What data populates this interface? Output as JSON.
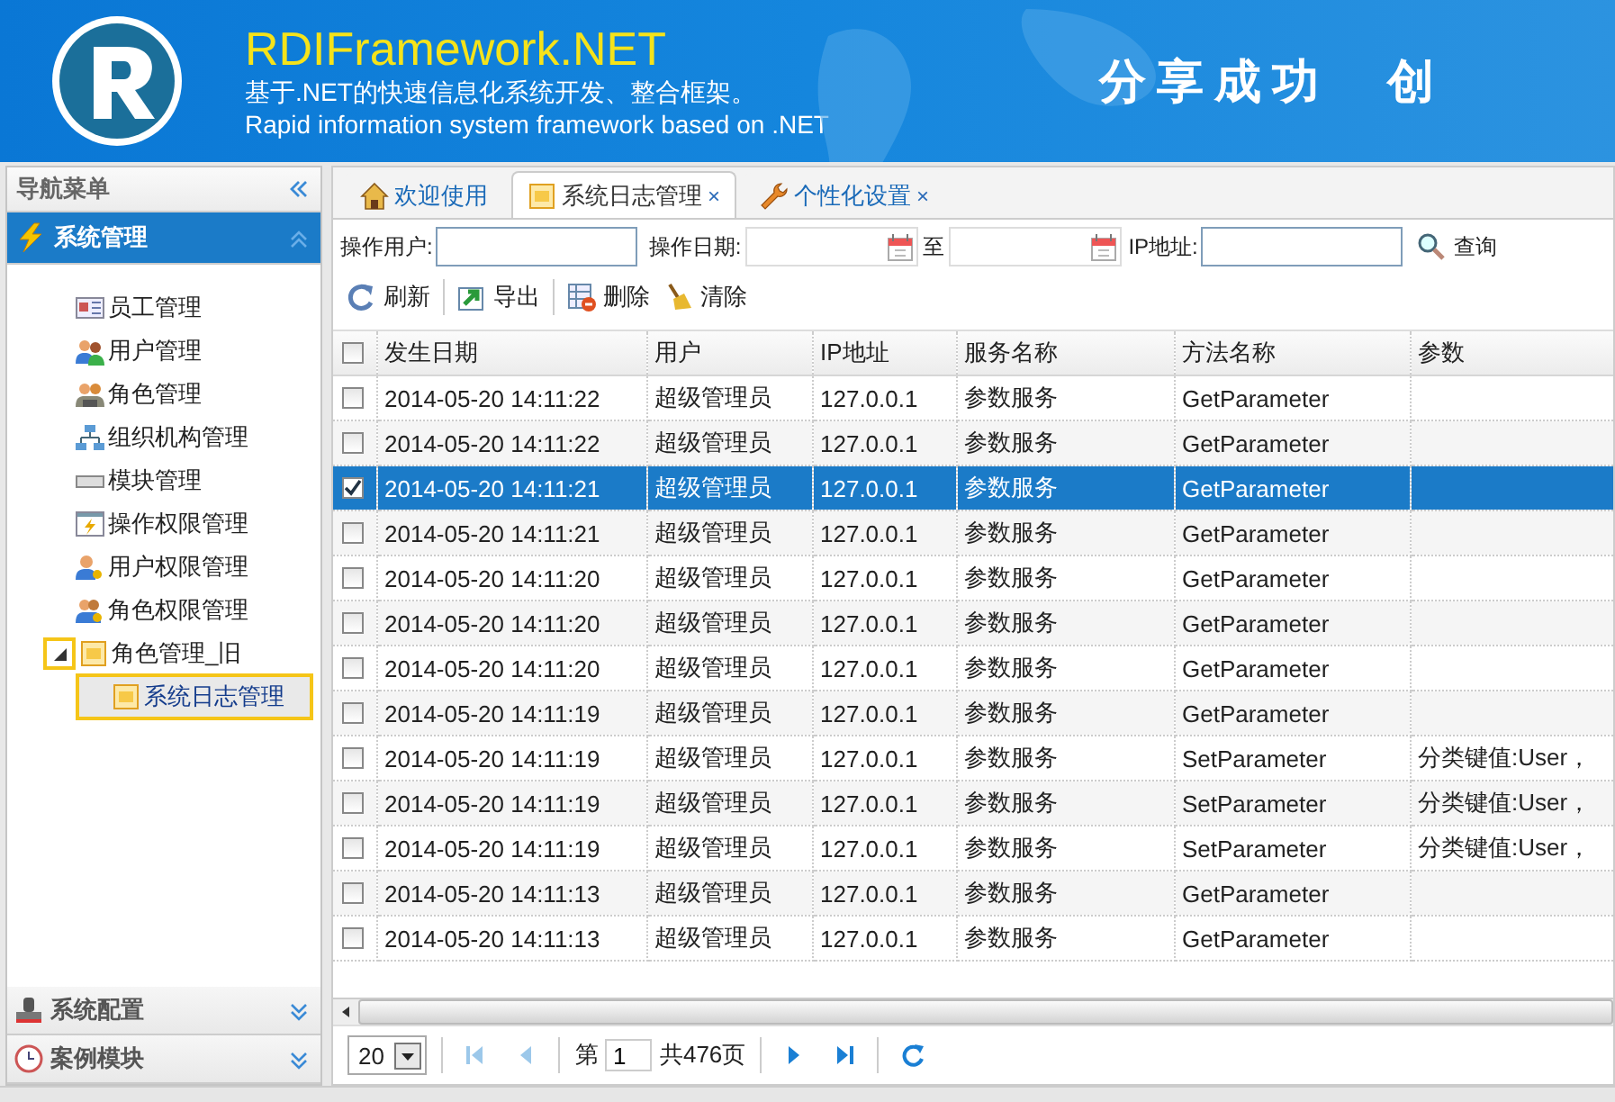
{
  "header": {
    "title": "RDIFramework.NET",
    "slogan_cn": "基于.NET的快速信息化系统开发、整合框架。",
    "slogan_en": "Rapid information system framework based on .NET",
    "motto": "分享成功　创"
  },
  "sidebar": {
    "title": "导航菜单",
    "panels": [
      {
        "label": "系统管理",
        "expanded": true,
        "items": [
          {
            "label": "员工管理",
            "selected": false
          },
          {
            "label": "用户管理",
            "selected": false
          },
          {
            "label": "角色管理",
            "selected": false
          },
          {
            "label": "组织机构管理",
            "selected": false
          },
          {
            "label": "模块管理",
            "selected": false
          },
          {
            "label": "操作权限管理",
            "selected": false
          },
          {
            "label": "用户权限管理",
            "selected": false
          },
          {
            "label": "角色权限管理",
            "selected": false
          },
          {
            "label": "角色管理_旧",
            "selected": false,
            "expanded": true,
            "children": [
              {
                "label": "系统日志管理",
                "selected": true
              }
            ]
          }
        ]
      },
      {
        "label": "系统配置",
        "expanded": false
      },
      {
        "label": "案例模块",
        "expanded": false
      }
    ]
  },
  "tabs": [
    {
      "label": "欢迎使用",
      "selected": false
    },
    {
      "label": "系统日志管理",
      "selected": true,
      "close": "×"
    },
    {
      "label": "个性化设置",
      "selected": false,
      "close": "×"
    }
  ],
  "filters": [
    {
      "label": "操作用户:",
      "kind": "text"
    },
    {
      "label": "操作日期:",
      "kind": "date"
    },
    {
      "label": "至",
      "kind": "date"
    },
    {
      "label": "IP地址:",
      "kind": "text"
    }
  ],
  "search_button": "查询",
  "toolbar": [
    "刷新",
    "导出",
    "删除",
    "清除"
  ],
  "table": {
    "all_checked": false,
    "columns": [
      "发生日期",
      "用户",
      "IP地址",
      "服务名称",
      "方法名称",
      "参数"
    ],
    "rows": [
      {
        "cells": [
          "2014-05-20 14:11:22",
          "超级管理员",
          "127.0.0.1",
          "参数服务",
          "GetParameter",
          ""
        ],
        "checked": false,
        "selected": false
      },
      {
        "cells": [
          "2014-05-20 14:11:22",
          "超级管理员",
          "127.0.0.1",
          "参数服务",
          "GetParameter",
          ""
        ],
        "checked": false,
        "selected": false
      },
      {
        "cells": [
          "2014-05-20 14:11:21",
          "超级管理员",
          "127.0.0.1",
          "参数服务",
          "GetParameter",
          ""
        ],
        "checked": true,
        "selected": true
      },
      {
        "cells": [
          "2014-05-20 14:11:21",
          "超级管理员",
          "127.0.0.1",
          "参数服务",
          "GetParameter",
          ""
        ],
        "checked": false,
        "selected": false
      },
      {
        "cells": [
          "2014-05-20 14:11:20",
          "超级管理员",
          "127.0.0.1",
          "参数服务",
          "GetParameter",
          ""
        ],
        "checked": false,
        "selected": false
      },
      {
        "cells": [
          "2014-05-20 14:11:20",
          "超级管理员",
          "127.0.0.1",
          "参数服务",
          "GetParameter",
          ""
        ],
        "checked": false,
        "selected": false
      },
      {
        "cells": [
          "2014-05-20 14:11:20",
          "超级管理员",
          "127.0.0.1",
          "参数服务",
          "GetParameter",
          ""
        ],
        "checked": false,
        "selected": false
      },
      {
        "cells": [
          "2014-05-20 14:11:19",
          "超级管理员",
          "127.0.0.1",
          "参数服务",
          "GetParameter",
          ""
        ],
        "checked": false,
        "selected": false
      },
      {
        "cells": [
          "2014-05-20 14:11:19",
          "超级管理员",
          "127.0.0.1",
          "参数服务",
          "SetParameter",
          "分类键值:User，"
        ],
        "checked": false,
        "selected": false
      },
      {
        "cells": [
          "2014-05-20 14:11:19",
          "超级管理员",
          "127.0.0.1",
          "参数服务",
          "SetParameter",
          "分类键值:User，"
        ],
        "checked": false,
        "selected": false
      },
      {
        "cells": [
          "2014-05-20 14:11:19",
          "超级管理员",
          "127.0.0.1",
          "参数服务",
          "SetParameter",
          "分类键值:User，"
        ],
        "checked": false,
        "selected": false
      },
      {
        "cells": [
          "2014-05-20 14:11:13",
          "超级管理员",
          "127.0.0.1",
          "参数服务",
          "GetParameter",
          ""
        ],
        "checked": false,
        "selected": false
      },
      {
        "cells": [
          "2014-05-20 14:11:13",
          "超级管理员",
          "127.0.0.1",
          "参数服务",
          "GetParameter",
          ""
        ],
        "checked": false,
        "selected": false
      }
    ]
  },
  "pager": {
    "page_size": "20",
    "page_prefix": "第",
    "page": "1",
    "total": "共476页"
  }
}
